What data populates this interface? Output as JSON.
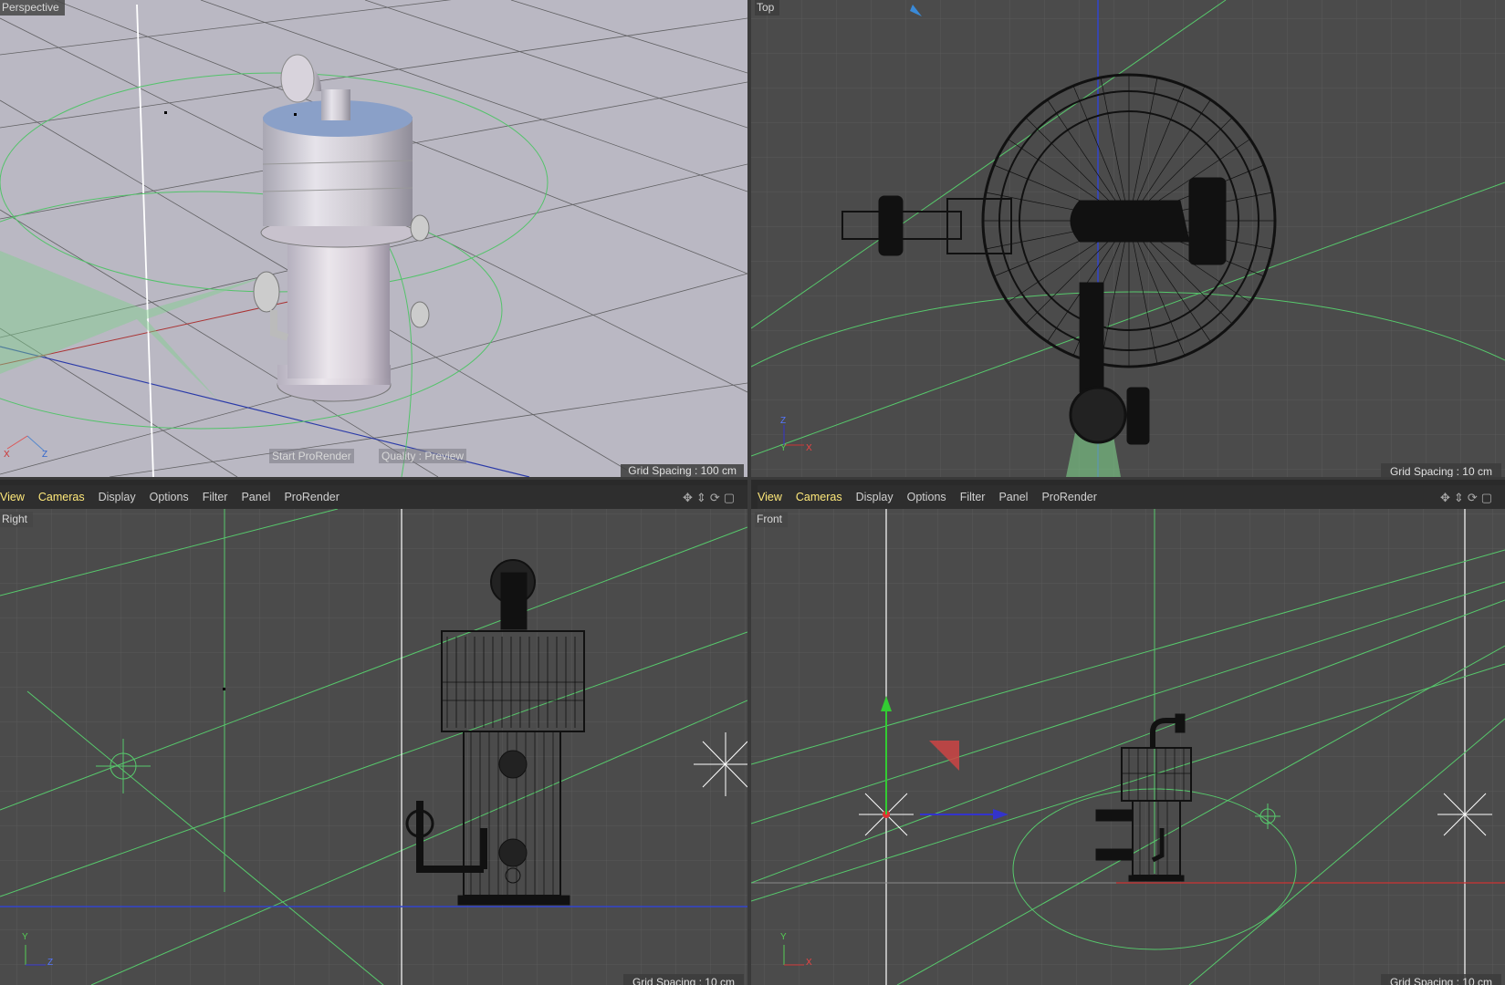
{
  "viewports": {
    "perspective": {
      "label": "Perspective",
      "grid_spacing": "Grid Spacing : 100 cm",
      "start_render": "Start ProRender",
      "quality": "Quality : Preview",
      "axis_x": "X",
      "axis_z": "Z"
    },
    "top": {
      "label": "Top",
      "grid_spacing": "Grid Spacing : 10 cm",
      "axis_a": "Z",
      "axis_b": "Y",
      "axis_c": "X"
    },
    "right": {
      "label": "Right",
      "grid_spacing": "Grid Spacing : 10 cm",
      "axis_a": "Y",
      "axis_b": "Z"
    },
    "front": {
      "label": "Front",
      "grid_spacing": "Grid Spacing : 10 cm",
      "axis_a": "Y",
      "axis_b": "X"
    }
  },
  "menus": {
    "view": "View",
    "cameras": "Cameras",
    "display": "Display",
    "options": "Options",
    "filter": "Filter",
    "panel": "Panel",
    "prorender": "ProRender"
  },
  "nav_icons": [
    "move-view-icon",
    "zoom-view-icon",
    "rotate-view-icon",
    "toggle-panel-icon"
  ]
}
